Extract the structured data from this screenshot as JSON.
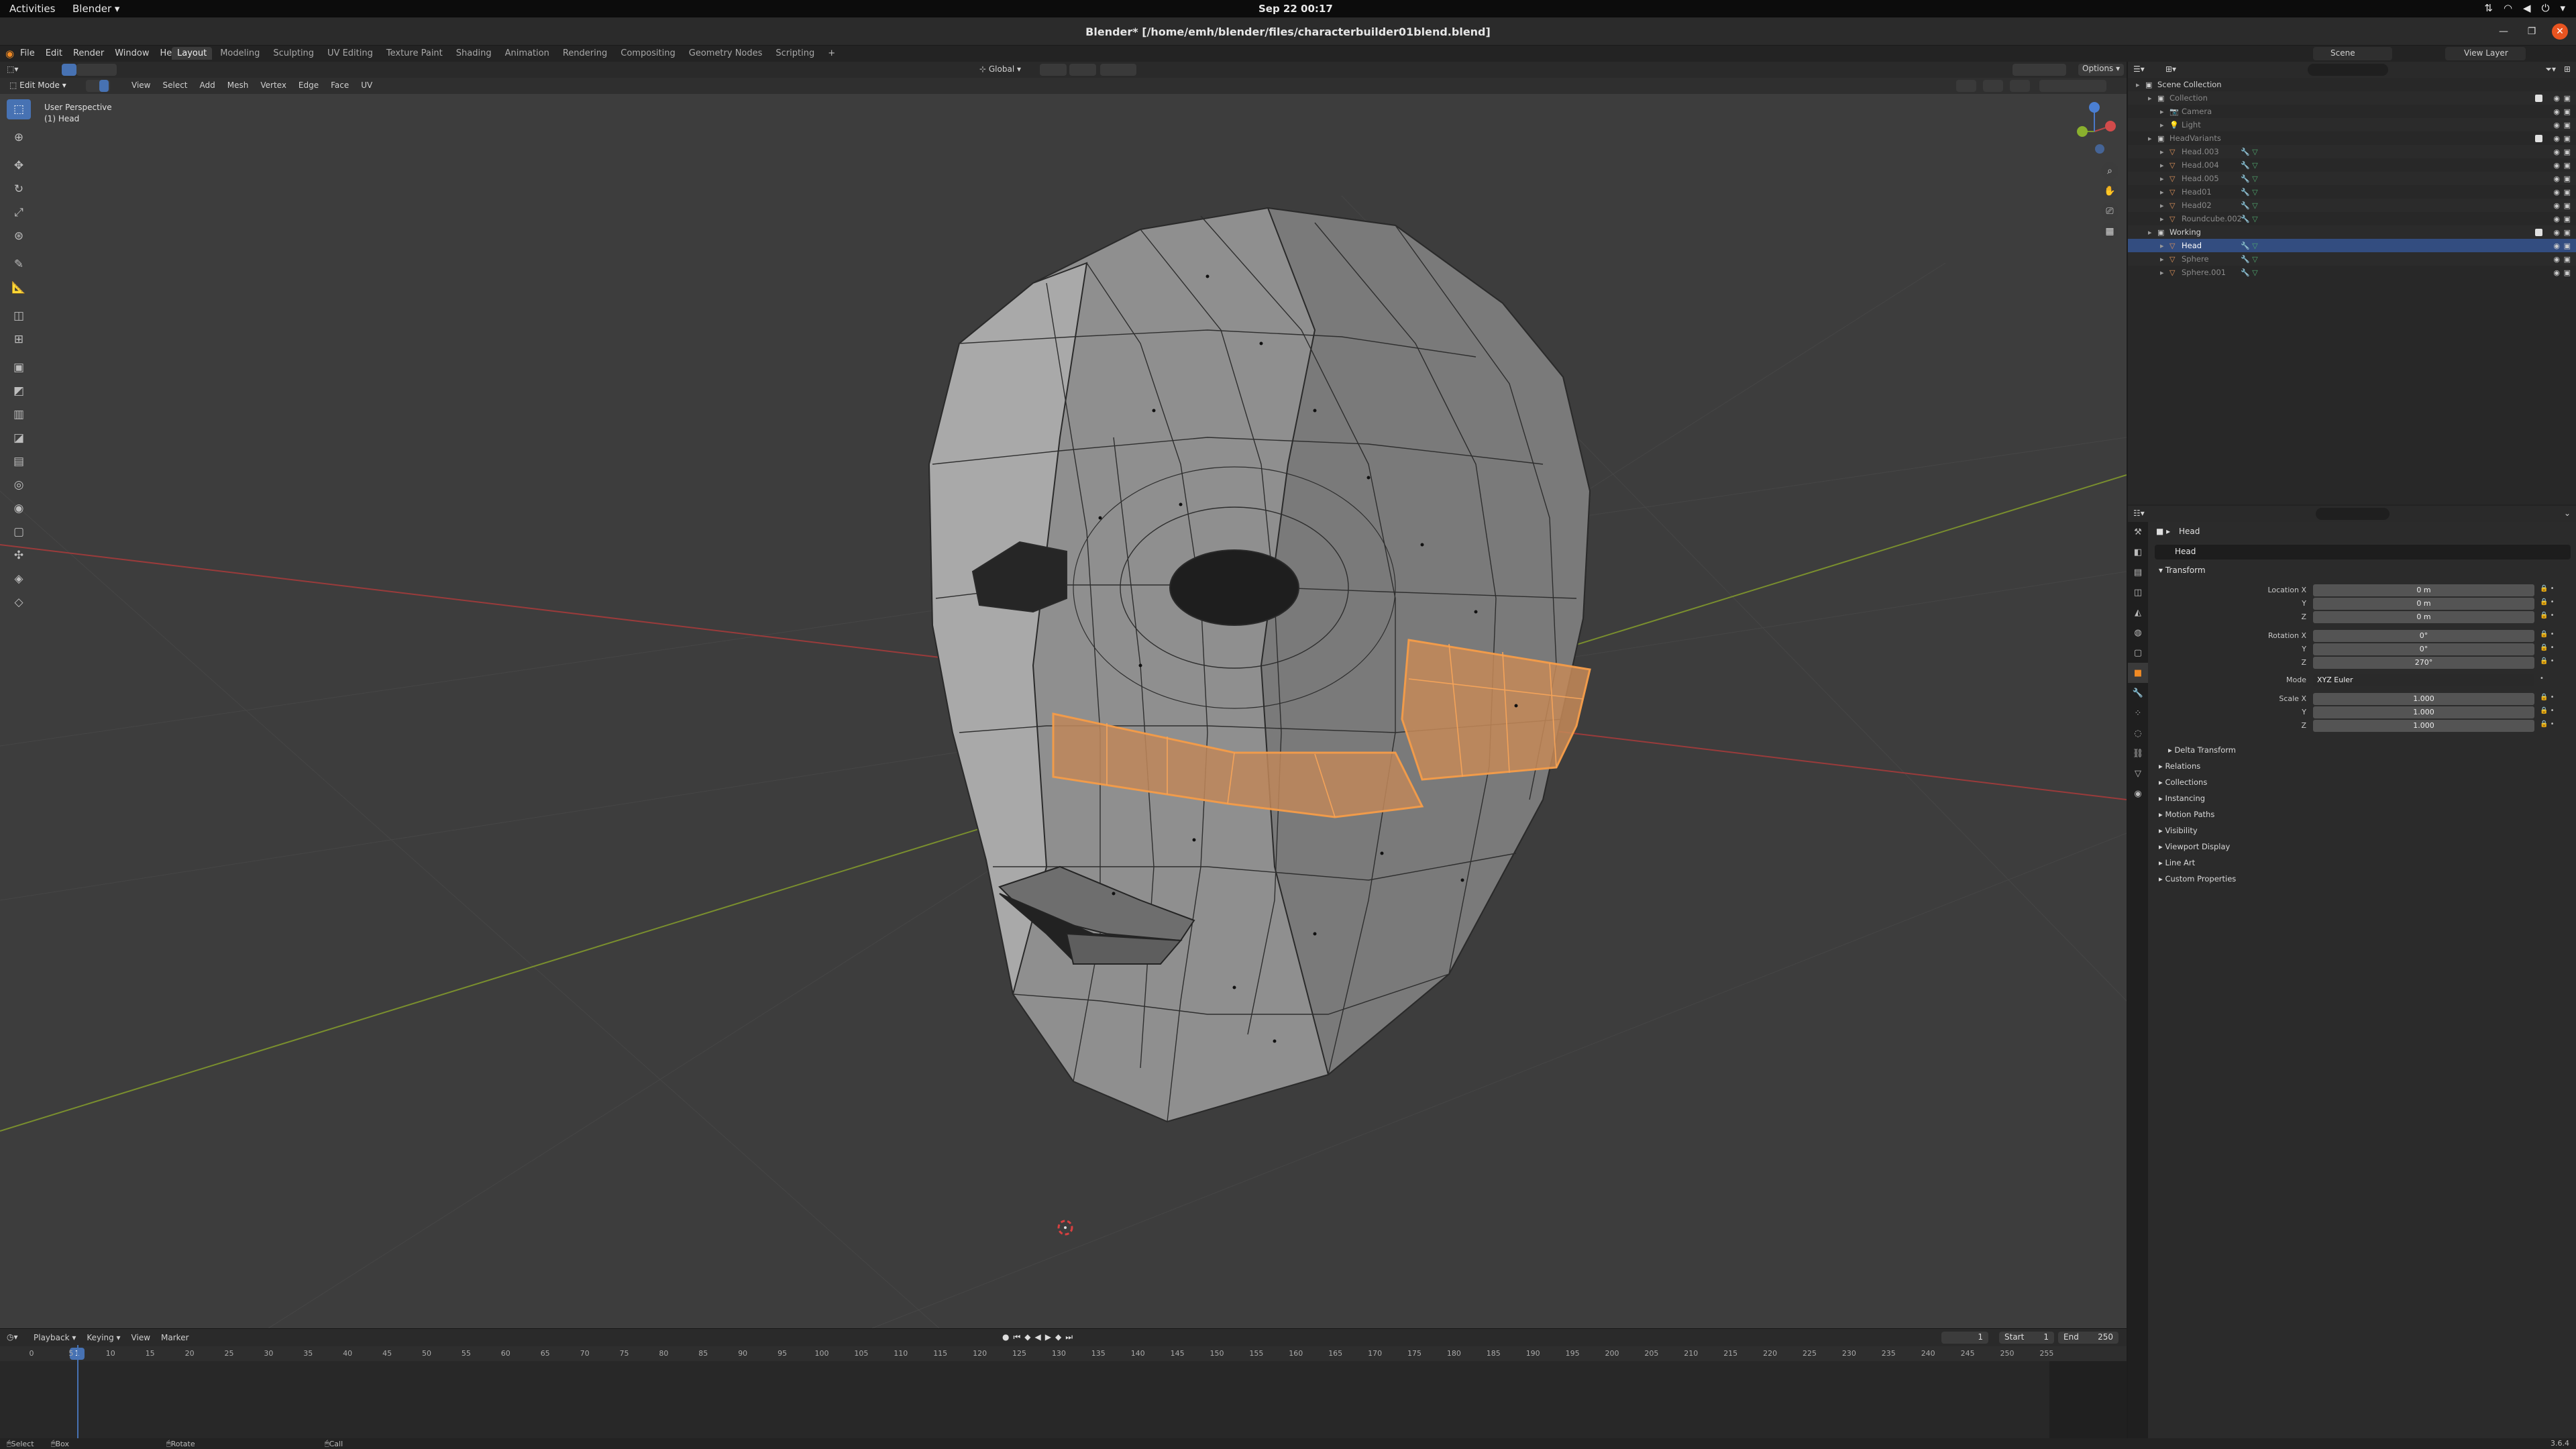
{
  "gnome": {
    "activities": "Activities",
    "app_menu": "Blender ▾",
    "clock": "Sep 22  00:17"
  },
  "window": {
    "title": "Blender* [/home/emh/blender/files/characterbuilder01blend.blend]"
  },
  "menubar": {
    "menus": [
      "File",
      "Edit",
      "Render",
      "Window",
      "Help"
    ],
    "workspaces": [
      "Layout",
      "Modeling",
      "Sculpting",
      "UV Editing",
      "Texture Paint",
      "Shading",
      "Animation",
      "Rendering",
      "Compositing",
      "Geometry Nodes",
      "Scripting",
      "+"
    ],
    "active_workspace": "Layout",
    "scene": "Scene",
    "view_layer": "View Layer"
  },
  "viewport": {
    "mode": "Edit Mode",
    "menus": [
      "View",
      "Select",
      "Add",
      "Mesh",
      "Vertex",
      "Edge",
      "Face",
      "UV"
    ],
    "orientation": "Global",
    "options": "Options",
    "view_name": "User Perspective",
    "object_label": "(1) Head",
    "colors": {
      "background": "#3d3d3d",
      "selection": "#e8953f",
      "x_axis": "#9a3b3b",
      "y_axis": "#7a8f2e"
    }
  },
  "timeline": {
    "menus": [
      "Playback ▾",
      "Keying ▾",
      "View",
      "Marker"
    ],
    "current_frame": "1",
    "start_label": "Start",
    "start": "1",
    "end_label": "End",
    "end": "250",
    "ruler": [
      "0",
      "5",
      "10",
      "15",
      "20",
      "25",
      "30",
      "35",
      "40",
      "45",
      "50",
      "55",
      "60",
      "65",
      "70",
      "75",
      "80",
      "85",
      "90",
      "95",
      "100",
      "105",
      "110",
      "115",
      "120",
      "125",
      "130",
      "135",
      "140",
      "145",
      "150",
      "155",
      "160",
      "165",
      "170",
      "175",
      "180",
      "185",
      "190",
      "195",
      "200",
      "205",
      "210",
      "215",
      "220",
      "225",
      "230",
      "235",
      "240",
      "245",
      "250",
      "255"
    ],
    "playhead_label": "1"
  },
  "statusbar": {
    "select": "Select",
    "box_select": "Box Select",
    "rotate_view": "Rotate View",
    "call_menu": "Call Menu",
    "version": "3.6.4"
  },
  "outliner": {
    "rows": [
      {
        "name": "Scene Collection",
        "indent": 0,
        "icon": "collection-icon",
        "dim": false,
        "active": false,
        "checkbox": false
      },
      {
        "name": "Collection",
        "indent": 1,
        "icon": "collection-icon",
        "dim": true,
        "active": false,
        "checkbox": true
      },
      {
        "name": "Camera",
        "indent": 2,
        "icon": "camera-icon",
        "dim": true,
        "active": false,
        "checkbox": false
      },
      {
        "name": "Light",
        "indent": 2,
        "icon": "light-icon",
        "dim": true,
        "active": false,
        "checkbox": false
      },
      {
        "name": "HeadVariants",
        "indent": 1,
        "icon": "collection-icon",
        "dim": true,
        "active": false,
        "checkbox": true
      },
      {
        "name": "Head.003",
        "indent": 2,
        "icon": "mesh-icon",
        "dim": true,
        "active": false,
        "checkbox": false
      },
      {
        "name": "Head.004",
        "indent": 2,
        "icon": "mesh-icon",
        "dim": true,
        "active": false,
        "checkbox": false
      },
      {
        "name": "Head.005",
        "indent": 2,
        "icon": "mesh-icon",
        "dim": true,
        "active": false,
        "checkbox": false
      },
      {
        "name": "Head01",
        "indent": 2,
        "icon": "mesh-icon",
        "dim": true,
        "active": false,
        "checkbox": false
      },
      {
        "name": "Head02",
        "indent": 2,
        "icon": "mesh-icon",
        "dim": true,
        "active": false,
        "checkbox": false
      },
      {
        "name": "Roundcube.002",
        "indent": 2,
        "icon": "mesh-icon",
        "dim": true,
        "active": false,
        "checkbox": false
      },
      {
        "name": "Working",
        "indent": 1,
        "icon": "collection-icon",
        "dim": false,
        "active": false,
        "checkbox": true
      },
      {
        "name": "Head",
        "indent": 2,
        "icon": "mesh-icon",
        "dim": false,
        "active": true,
        "checkbox": false
      },
      {
        "name": "Sphere",
        "indent": 2,
        "icon": "mesh-icon",
        "dim": true,
        "active": false,
        "checkbox": false
      },
      {
        "name": "Sphere.001",
        "indent": 2,
        "icon": "mesh-icon",
        "dim": true,
        "active": false,
        "checkbox": false
      }
    ]
  },
  "properties": {
    "object_name": "Head",
    "data_name": "Head",
    "transform_label": "Transform",
    "location_label": "Location X",
    "location": [
      "0 m",
      "0 m",
      "0 m"
    ],
    "rotation_label": "Rotation X",
    "rotation": [
      "0°",
      "0°",
      "270°"
    ],
    "mode_label": "Mode",
    "mode": "XYZ Euler",
    "scale_label": "Scale X",
    "scale": [
      "1.000",
      "1.000",
      "1.000"
    ],
    "axis_y": "Y",
    "axis_z": "Z",
    "delta_transform": "Delta Transform",
    "panels": [
      "Relations",
      "Collections",
      "Instancing",
      "Motion Paths",
      "Visibility",
      "Viewport Display",
      "Line Art",
      "Custom Properties"
    ]
  }
}
